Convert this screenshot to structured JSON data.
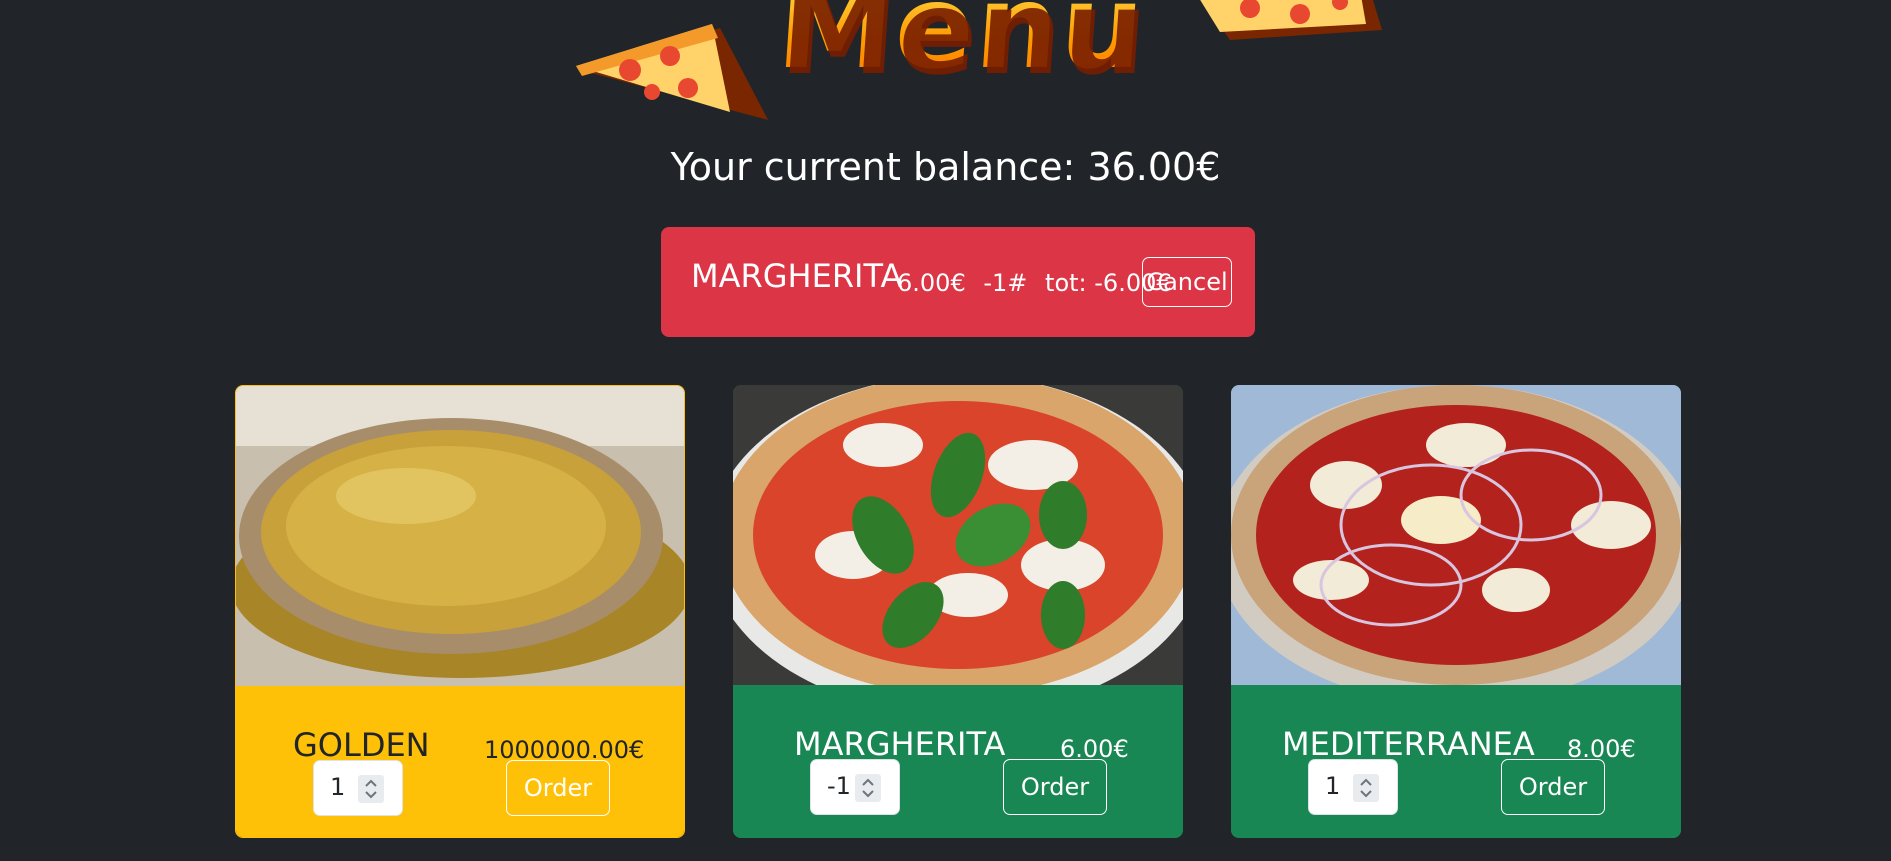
{
  "header": {
    "logo_text": "Menu",
    "balance_text": "Your current balance: 36.00€"
  },
  "cart": {
    "item_name": "MARGHERITA",
    "unit_price": "6.00€",
    "quantity": "-1#",
    "total": "tot: -6.00€",
    "cancel_label": "Cancel",
    "color": "#dc3545"
  },
  "products": [
    {
      "name": "GOLDEN",
      "price": "1000000.00€",
      "qty": "1",
      "order_label": "Order",
      "color": "#ffc107",
      "image": "golden-pizza"
    },
    {
      "name": "MARGHERITA",
      "price": "6.00€",
      "qty": "-1",
      "order_label": "Order",
      "color": "#198754",
      "image": "margherita-pizza"
    },
    {
      "name": "MEDITERRANEA",
      "price": "8.00€",
      "qty": "1",
      "order_label": "Order",
      "color": "#198754",
      "image": "mediterranea-pizza"
    }
  ],
  "colors": {
    "background": "#212529",
    "success": "#198754",
    "warning": "#ffc107",
    "danger": "#dc3545"
  }
}
